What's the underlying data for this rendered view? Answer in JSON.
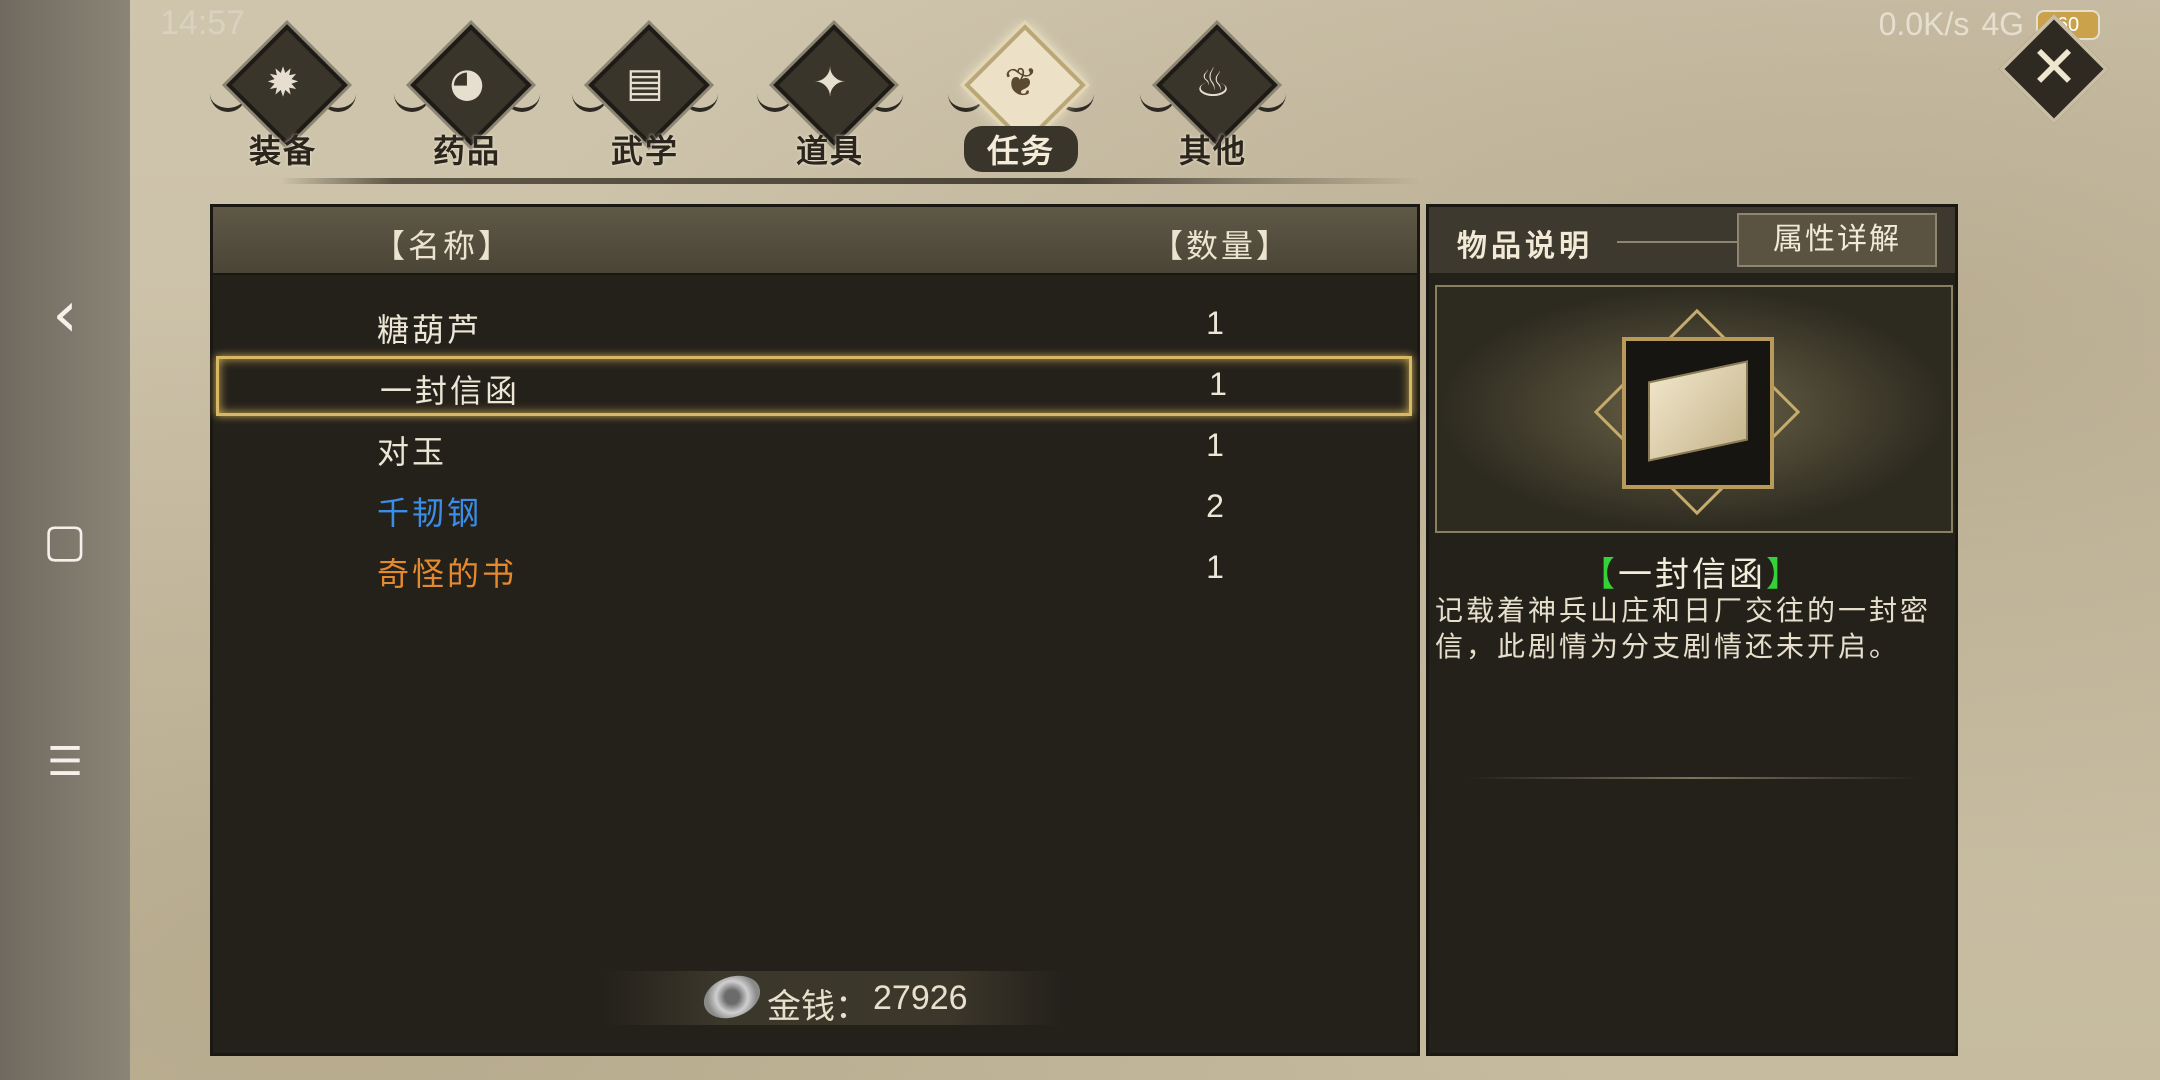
{
  "status": {
    "time": "14:57",
    "net": "0.0K/s",
    "signal": "4G",
    "battery": "60"
  },
  "tabs": [
    {
      "label": "装备",
      "glyph": "✹",
      "icon": "armor-icon"
    },
    {
      "label": "药品",
      "glyph": "◕",
      "icon": "medicine-icon"
    },
    {
      "label": "武学",
      "glyph": "▤",
      "icon": "martial-arts-book-icon"
    },
    {
      "label": "道具",
      "glyph": "✦",
      "icon": "tools-icon"
    },
    {
      "label": "任务",
      "glyph": "❦",
      "icon": "quest-scroll-icon"
    },
    {
      "label": "其他",
      "glyph": "♨",
      "icon": "flame-icon"
    }
  ],
  "active_tab": "任务",
  "list": {
    "header_name": "【名称】",
    "header_qty": "【数量】",
    "items": [
      {
        "name": "糖葫芦",
        "qty": "1",
        "color": "#ece6d6"
      },
      {
        "name": "一封信函",
        "qty": "1",
        "color": "#ece6d6"
      },
      {
        "name": "对玉",
        "qty": "1",
        "color": "#ece6d6"
      },
      {
        "name": "千韧钢",
        "qty": "2",
        "color": "#3b8ee8"
      },
      {
        "name": "奇怪的书",
        "qty": "1",
        "color": "#e5892f"
      }
    ],
    "selected_index": 1
  },
  "money": {
    "label": "金钱：",
    "value": "27926"
  },
  "detail": {
    "tab_description": "物品说明",
    "tab_attributes": "属性详解",
    "item_name": "一封信函",
    "bracket_open": "【",
    "bracket_close": "】",
    "description": "记载着神兵山庄和日厂交往的一封密信，此剧情为分支剧情还未开启。"
  },
  "nav": {
    "back": "‹",
    "home": "▢",
    "menu": "☰"
  }
}
